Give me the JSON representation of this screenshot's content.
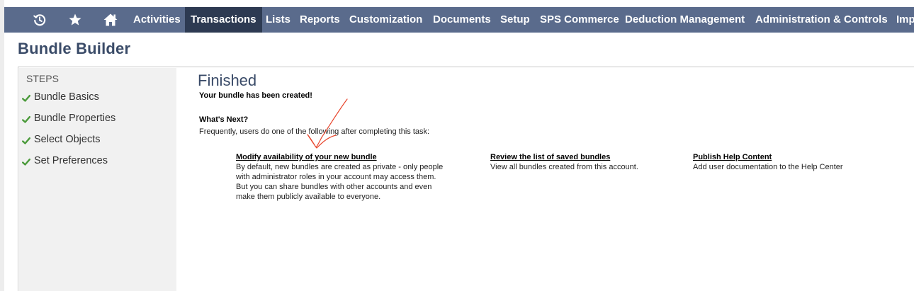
{
  "nav": {
    "icons": [
      "recent-icon",
      "star-icon",
      "home-icon"
    ],
    "items": [
      {
        "label": "Activities"
      },
      {
        "label": "Transactions"
      },
      {
        "label": "Lists"
      },
      {
        "label": "Reports"
      },
      {
        "label": "Customization"
      },
      {
        "label": "Documents"
      },
      {
        "label": "Setup"
      },
      {
        "label": "SPS Commerce"
      },
      {
        "label": "Deduction Management"
      },
      {
        "label": "Administration & Controls"
      },
      {
        "label": "Imp"
      }
    ],
    "active": "Transactions",
    "bar_color": "#5a6b8c",
    "active_color": "#2d3a52"
  },
  "page": {
    "title": "Bundle Builder"
  },
  "steps": {
    "heading": "STEPS",
    "items": [
      {
        "label": "Bundle Basics",
        "status": "complete"
      },
      {
        "label": "Bundle Properties",
        "status": "complete"
      },
      {
        "label": "Select Objects",
        "status": "complete"
      },
      {
        "label": "Set Preferences",
        "status": "complete"
      }
    ],
    "check_color": "#4a9a3a"
  },
  "main": {
    "title": "Finished",
    "created_message": "Your bundle has been created!",
    "whats_next_heading": "What's Next?",
    "whats_next_desc": "Frequently, users do one of the following after completing this task:",
    "options": [
      {
        "link": "Modify availability of your new bundle",
        "lines": [
          "By default, new bundles are created as private - only people",
          "with administrator roles in your account may access them.",
          "But you can share bundles with other accounts and even",
          "make them publicly available to everyone."
        ]
      },
      {
        "link": "Review the list of saved bundles",
        "lines": [
          "View all bundles created from this account."
        ]
      },
      {
        "link": "Publish Help Content",
        "lines": [
          "Add user documentation to the Help Center"
        ]
      }
    ]
  },
  "annotation_color": "#e8452c"
}
